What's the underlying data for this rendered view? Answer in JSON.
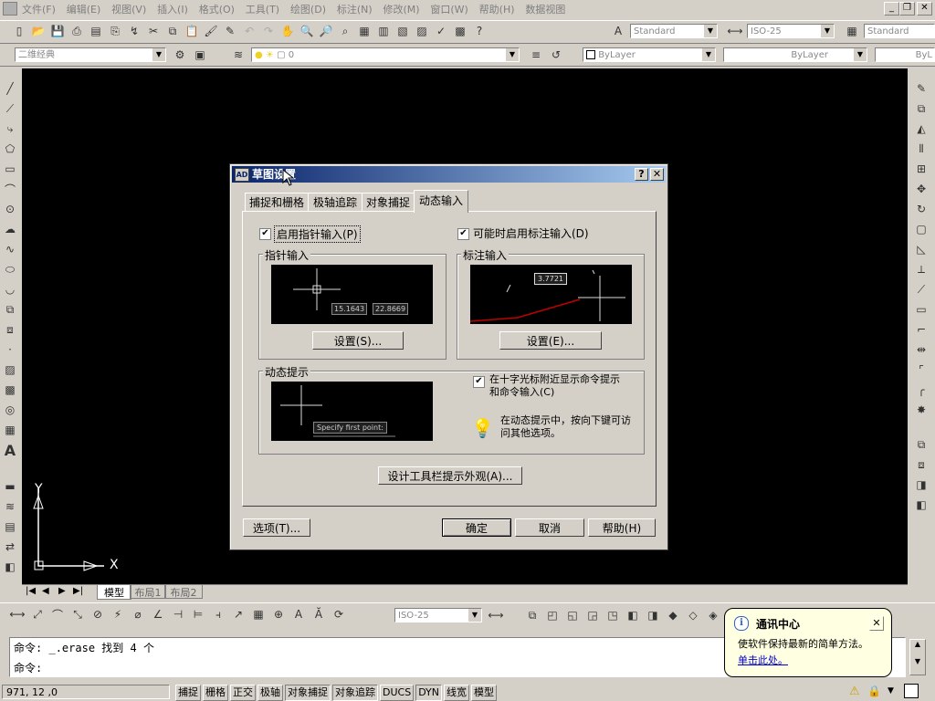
{
  "menu": {
    "items": [
      "文件(F)",
      "编辑(E)",
      "视图(V)",
      "插入(I)",
      "格式(O)",
      "工具(T)",
      "绘图(D)",
      "标注(N)",
      "修改(M)",
      "窗口(W)",
      "帮助(H)",
      "数据视图"
    ]
  },
  "toolbars": {
    "text_style": "Standard",
    "dim_style": "ISO-25",
    "table_style": "Standard",
    "workspace": "二维经典",
    "layer": "0",
    "color": "ByLayer",
    "linetype": "ByLayer",
    "lineweight": "ByL",
    "dim_style_2": "ISO-25"
  },
  "layout_tabs": [
    "模型",
    "布局1",
    "布局2"
  ],
  "ucs": {
    "x": "X",
    "y": "Y"
  },
  "dialog": {
    "title": "草图设置",
    "tabs": [
      "捕捉和栅格",
      "极轴追踪",
      "对象捕捉",
      "动态输入"
    ],
    "active_tab": "动态输入",
    "enable_pointer_input": "启用指针输入(P)",
    "enable_dim_input": "可能时启用标注输入(D)",
    "pointer_input_group": "指针输入",
    "pointer_preview_values": [
      "15.1643",
      "22.8669"
    ],
    "pointer_settings_btn": "设置(S)...",
    "dim_input_group": "标注输入",
    "dim_preview_value": "3.7721",
    "dim_settings_btn": "设置(E)...",
    "dynamic_prompt_group": "动态提示",
    "prompt_preview_text": "Specify first point:",
    "show_prompt_line1": "在十字光标附近显示命令提示",
    "show_prompt_line2": "和命令输入(C)",
    "tip_line1": "在动态提示中，按向下键可访",
    "tip_line2": "问其他选项。",
    "tooltip_btn": "设计工具栏提示外观(A)...",
    "options_btn": "选项(T)...",
    "ok_btn": "确定",
    "cancel_btn": "取消",
    "help_btn": "帮助(H)"
  },
  "command": {
    "line1_prefix": "命令:",
    "line1_text": "_.erase 找到 4 个",
    "line2_prefix": "命令:"
  },
  "status": {
    "coords": "971, 12 ,0",
    "toggles": [
      "捕捉",
      "栅格",
      "正交",
      "极轴",
      "对象捕捉",
      "对象追踪",
      "DUCS",
      "DYN",
      "线宽",
      "模型"
    ]
  },
  "notification": {
    "title": "通讯中心",
    "body": "使软件保持最新的简单方法。",
    "link": "单击此处。"
  }
}
